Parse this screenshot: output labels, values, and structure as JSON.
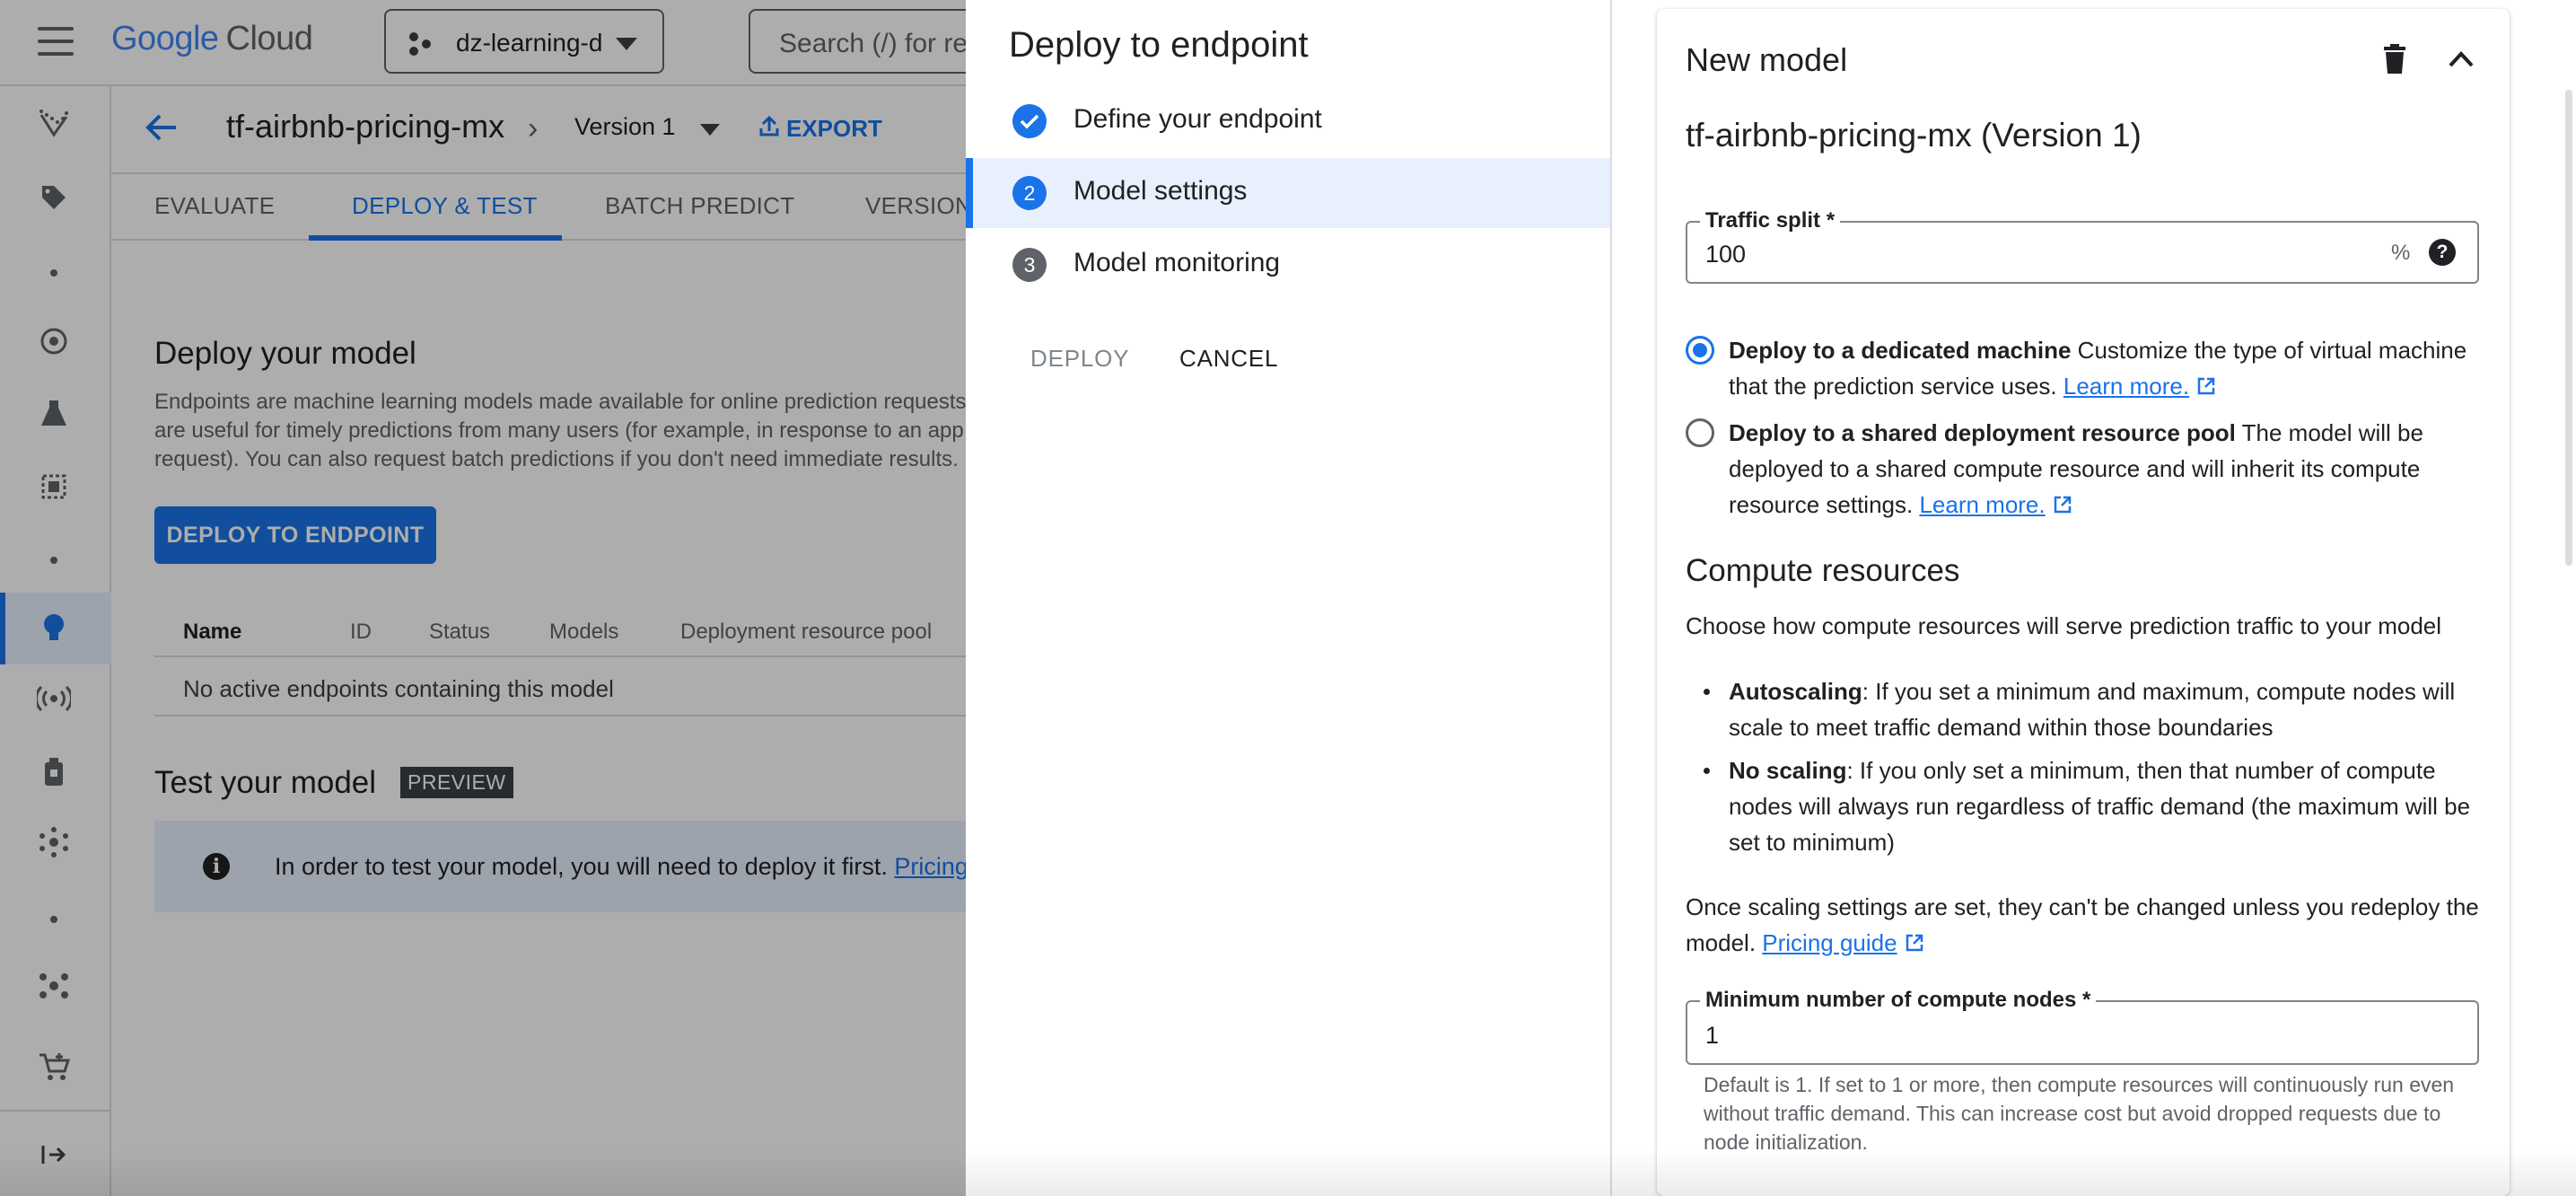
{
  "header": {
    "logo_google": "Google",
    "logo_cloud": "Cloud",
    "project": "dz-learning-d",
    "search_placeholder": "Search (/) for re"
  },
  "model_header": {
    "title": "tf-airbnb-pricing-mx",
    "version": "Version 1",
    "export_label": "EXPORT"
  },
  "tabs": [
    {
      "label": "EVALUATE"
    },
    {
      "label": "DEPLOY & TEST",
      "active": true
    },
    {
      "label": "BATCH PREDICT"
    },
    {
      "label": "VERSION"
    }
  ],
  "deploy_section": {
    "heading": "Deploy your model",
    "description": "Endpoints are machine learning models made available for online prediction requests are useful for timely predictions from many users (for example, in response to an app request). You can also request batch predictions if you don't need immediate results.",
    "button_label": "DEPLOY TO ENDPOINT",
    "table_headers": [
      "Name",
      "ID",
      "Status",
      "Models",
      "Deployment resource pool"
    ],
    "empty_message": "No active endpoints containing this model"
  },
  "test_section": {
    "heading": "Test your model",
    "badge": "PREVIEW",
    "info_text": "In order to test your model, you will need to deploy it first.",
    "info_link": "Pricing gui"
  },
  "stepper": {
    "title": "Deploy to endpoint",
    "steps": [
      {
        "label": "Define your endpoint",
        "state": "complete"
      },
      {
        "number": "2",
        "label": "Model settings",
        "state": "active"
      },
      {
        "number": "3",
        "label": "Model monitoring",
        "state": "pending"
      }
    ],
    "deploy_label": "DEPLOY",
    "cancel_label": "CANCEL"
  },
  "form": {
    "card_title": "New model",
    "model_title": "tf-airbnb-pricing-mx (Version 1)",
    "traffic_split_label": "Traffic split *",
    "traffic_split_value": "100",
    "traffic_split_suffix": "%",
    "option_dedicated": {
      "title": "Deploy to a dedicated machine",
      "text": " Customize the type of virtual machine that the prediction service uses. ",
      "link": "Learn more.",
      "selected": true
    },
    "option_shared": {
      "title": "Deploy to a shared deployment resource pool",
      "text": " The model will be deployed to a shared compute resource and will inherit its compute resource settings. ",
      "link": "Learn more.",
      "selected": false
    },
    "compute_heading": "Compute resources",
    "compute_desc": "Choose how compute resources will serve prediction traffic to your model",
    "bullets": [
      {
        "title": "Autoscaling",
        "text": ": If you set a minimum and maximum, compute nodes will scale to meet traffic demand within those boundaries"
      },
      {
        "title": "No scaling",
        "text": ": If you only set a minimum, then that number of compute nodes will always run regardless of traffic demand (the maximum will be set to minimum)"
      }
    ],
    "scaling_note": "Once scaling settings are set, they can't be changed unless you redeploy the model. ",
    "scaling_link": "Pricing guide",
    "min_nodes_label": "Minimum number of compute nodes *",
    "min_nodes_value": "1",
    "min_nodes_hint": "Default is 1. If set to 1 or more, then compute resources will continuously run even without traffic demand. This can increase cost but avoid dropped requests due to node initialization."
  },
  "colors": {
    "accent": "#1a73e8",
    "selected_bg": "#e8f0fe",
    "text": "#202124",
    "muted": "#5f6368"
  }
}
